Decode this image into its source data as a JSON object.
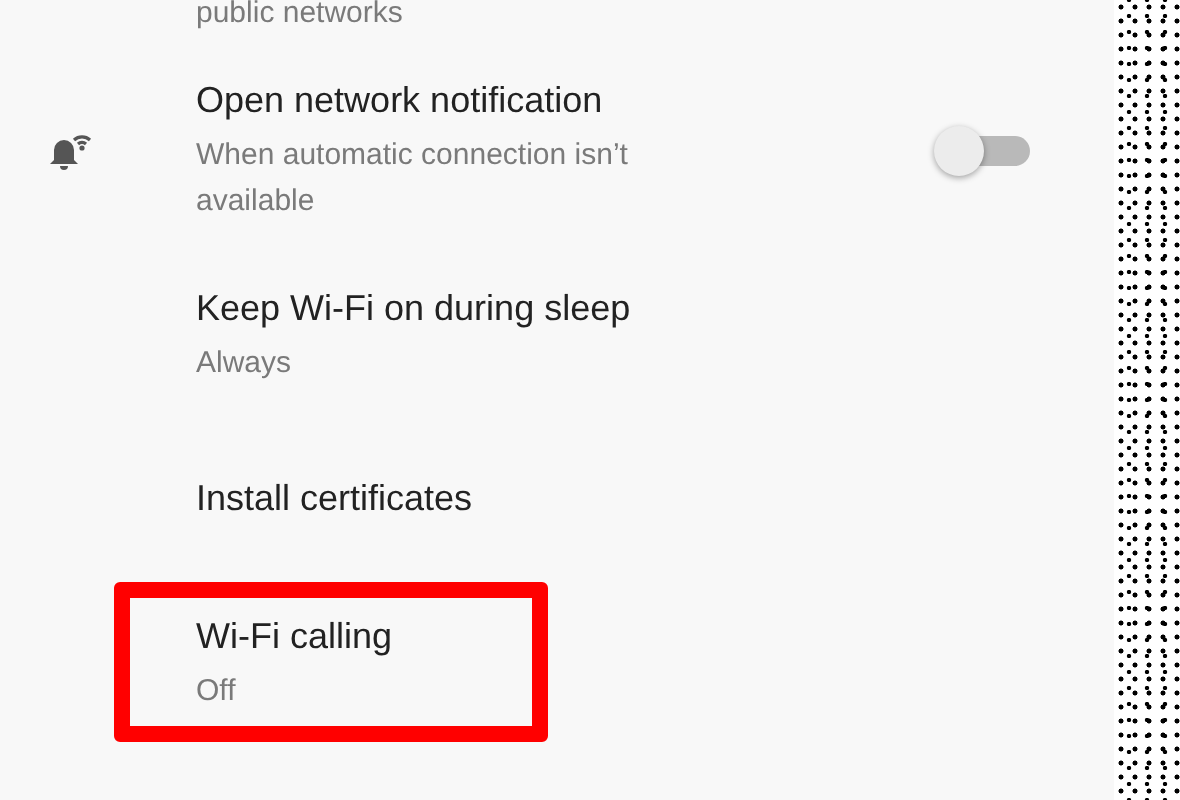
{
  "header_partial": {
    "text": "public networks"
  },
  "settings": [
    {
      "kind": "toggle",
      "title": "Open network notification",
      "subtitle": "When automatic connection isn’t available",
      "on": false,
      "highlighted": false
    },
    {
      "kind": "plain",
      "title": "Keep Wi-Fi on during sleep",
      "subtitle": "Always",
      "highlighted": false
    },
    {
      "kind": "plain",
      "title": "Install certificates",
      "highlighted": false
    },
    {
      "kind": "plain",
      "title": "Wi-Fi calling",
      "subtitle": "Off",
      "highlighted": true
    }
  ]
}
